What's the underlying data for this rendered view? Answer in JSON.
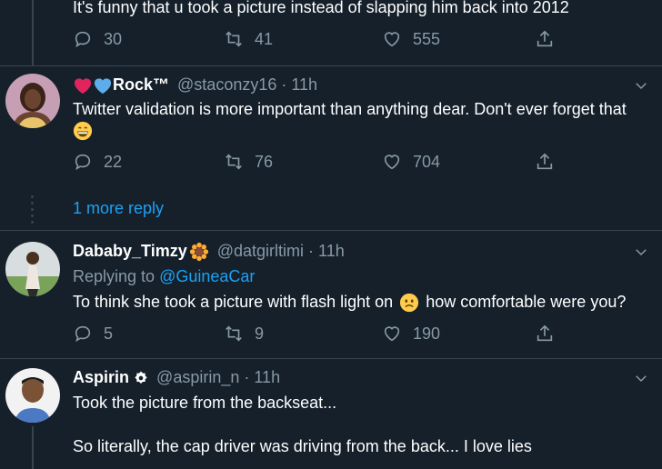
{
  "tweet1": {
    "text": "It's funny that u took a picture instead of slapping him back into 2012",
    "reply_count": "30",
    "retweet_count": "41",
    "like_count": "555"
  },
  "tweet2": {
    "name": "Rock™",
    "handle": "@staconzy16",
    "time": "· 11h",
    "text": "Twitter validation is more important than anything dear. Don't ever forget that",
    "reply_count": "22",
    "retweet_count": "76",
    "like_count": "704",
    "more_replies": "1 more reply"
  },
  "tweet3": {
    "name": "Dababy_Timzy",
    "handle": "@datgirltimi",
    "time": "· 11h",
    "replying_prefix": "Replying to",
    "replying_to": "@GuineaCar",
    "text_before": "To think she took a picture with flash light on",
    "text_after": "how comfortable were you?",
    "reply_count": "5",
    "retweet_count": "9",
    "like_count": "190"
  },
  "tweet4": {
    "name": "Aspirin",
    "handle": "@aspirin_n",
    "time": "· 11h",
    "line1": "Took the picture from the backseat...",
    "line2": "So literally, the cap driver was driving from the back... I love lies"
  },
  "icons": [
    "reply-icon",
    "retweet-icon",
    "like-icon",
    "share-icon",
    "caret-down-icon",
    "heart-emoji-icon",
    "grin-emoji-icon",
    "sunflower-emoji-icon",
    "frown-emoji-icon",
    "badge-icon"
  ],
  "colors": {
    "background": "#15202b",
    "link": "#1da1f2",
    "muted": "#8899a6",
    "divider": "#38444d"
  }
}
